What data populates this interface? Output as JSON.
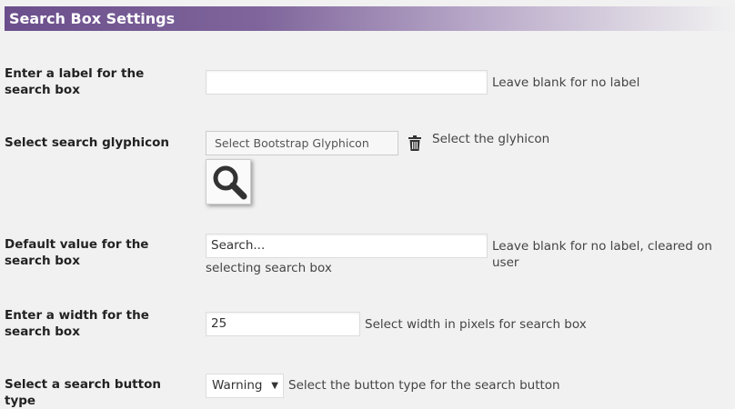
{
  "header": {
    "title": "Search Box Settings"
  },
  "rows": {
    "label": {
      "label": "Enter a label for the search box",
      "value": "",
      "description": "Leave blank for no label"
    },
    "glyphicon": {
      "label": "Select search glyphicon",
      "button_label": "Select Bootstrap Glyphicon",
      "description": "Select the glyhicon",
      "selected_icon": "search-icon"
    },
    "default_value": {
      "label": "Default value for the search box",
      "value": "Search...",
      "description_line1": "Leave blank for no label, cleared on user",
      "description_line2": "selecting search box"
    },
    "width": {
      "label": "Enter a width for the search box",
      "value": "25",
      "description": "Select width in pixels for search box"
    },
    "button_type": {
      "label": "Select a search button type",
      "selected": "Warning",
      "description": "Select the button type for the search button"
    }
  },
  "colors": {
    "header_start": "#6b4f8c",
    "background": "#f1f1f1"
  }
}
